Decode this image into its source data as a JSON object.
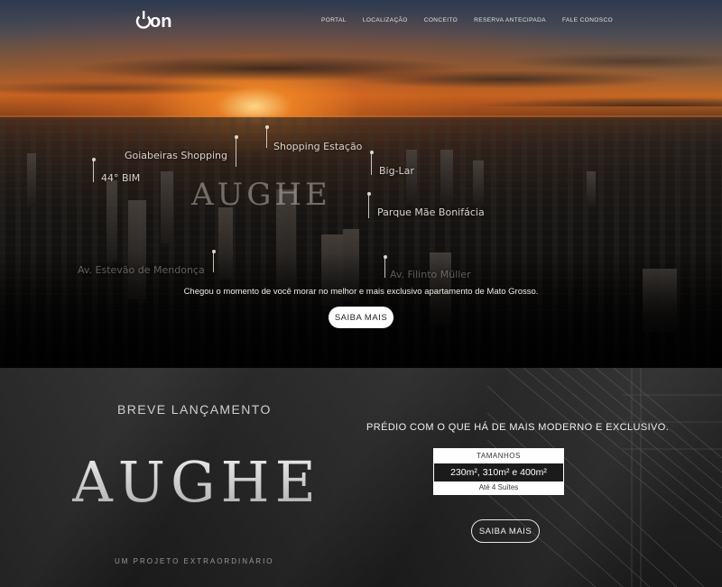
{
  "header": {
    "logo_text": "on",
    "nav": [
      "PORTAL",
      "LOCALIZAÇÃO",
      "CONCEITO",
      "RESERVA ANTECIPADA",
      "FALE CONOSCO"
    ]
  },
  "hero": {
    "wordmark": "AUGHE",
    "landmarks": [
      "Goiabeiras Shopping",
      "Shopping Estação",
      "44° BIM",
      "Big-Lar",
      "Parque Mãe Bonifácia",
      "Av. Estevão de Mendonça",
      "Av. Filinto Müller"
    ],
    "tagline": "Chegou o momento de você morar no melhor e mais exclusivo apartamento de Mato Grosso.",
    "button": "SAIBA MAIS"
  },
  "launch": {
    "eyebrow": "BREVE LANÇAMENTO",
    "wordmark": "AUGHE",
    "subtitle": "UM PROJETO EXTRAORDINÁRIO",
    "headline": "PRÉDIO COM O QUE HÁ DE MAIS MODERNO E EXCLUSIVO.",
    "sizes_label": "TAMANHOS",
    "sizes": "230m², 310m² e 400m²",
    "suites": "Até 4 Suítes",
    "button": "SAIBA MAIS"
  },
  "colors": {
    "accent_light": "#ffffff",
    "dark_bg": "#222222",
    "text_light": "#efefef"
  }
}
